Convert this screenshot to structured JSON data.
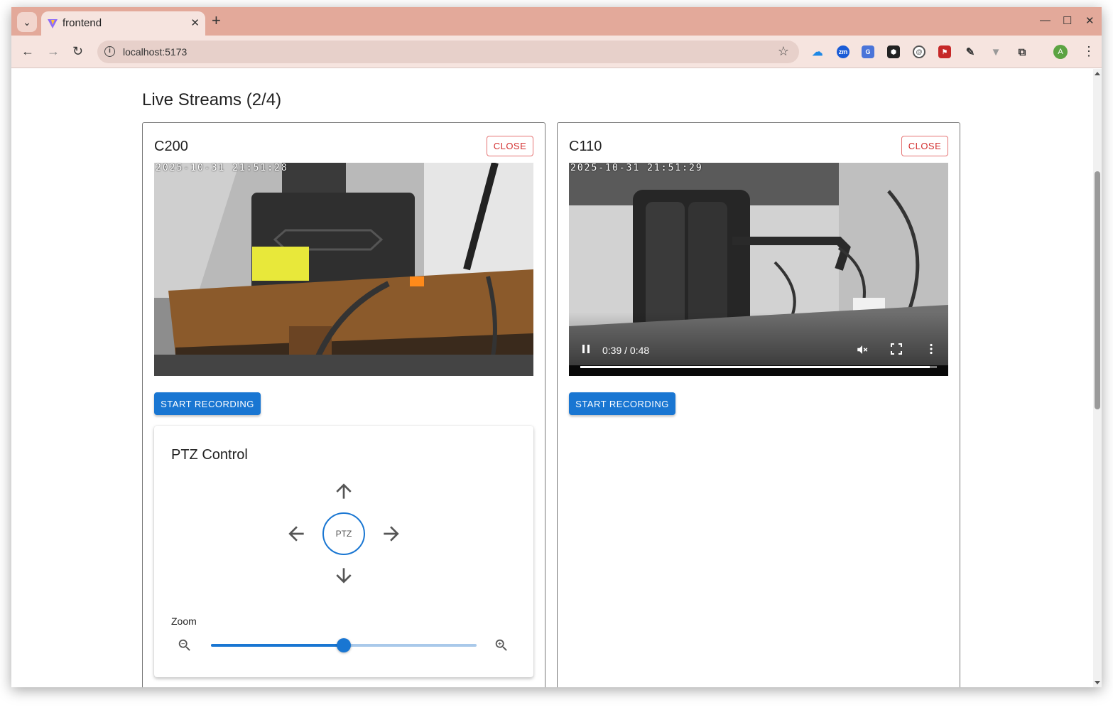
{
  "browser": {
    "tab_title": "frontend",
    "url": "localhost:5173",
    "avatar_letter": "A"
  },
  "page": {
    "title": "Live Streams (2/4)"
  },
  "streams": [
    {
      "name": "C200",
      "close_label": "CLOSE",
      "timestamp": "2025-10-31 21:51:28",
      "record_label": "START RECORDING"
    },
    {
      "name": "C110",
      "close_label": "CLOSE",
      "timestamp": "2025-10-31 21:51:29",
      "record_label": "START RECORDING",
      "player": {
        "time": "0:39 / 0:48",
        "progress": 0.98
      }
    }
  ],
  "ptz": {
    "title": "PTZ Control",
    "center_label": "PTZ",
    "zoom_label": "Zoom",
    "zoom_value": 0.5
  },
  "colors": {
    "primary": "#1976d2",
    "danger": "#d32f2f",
    "tabbar": "#e3a99a"
  }
}
